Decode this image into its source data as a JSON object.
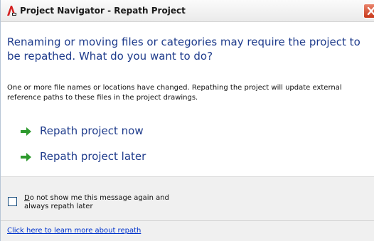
{
  "window": {
    "title": "Project Navigator - Repath Project",
    "app_icon": "autocad-a-icon",
    "close_icon": "close-icon"
  },
  "main_instruction": "Renaming or moving files or categories may require the project to be repathed. What do you want to do?",
  "content": "One or more file names or locations have changed. Repathing the project will update external reference paths to these files in the project drawings.",
  "commands": [
    {
      "label": "Repath project now",
      "icon": "green-arrow-icon"
    },
    {
      "label": "Repath project later",
      "icon": "green-arrow-icon"
    }
  ],
  "verification": {
    "checked": false,
    "accel_char": "D",
    "label_rest_line1": "o not show me this message again and",
    "label_line2": "always repath later"
  },
  "footer_link": "Click here to learn more about repath",
  "colors": {
    "instruction_blue": "#1f3c8c",
    "arrow_green": "#2e9a2e",
    "close_red": "#c8381a",
    "link_blue": "#0033cc"
  }
}
